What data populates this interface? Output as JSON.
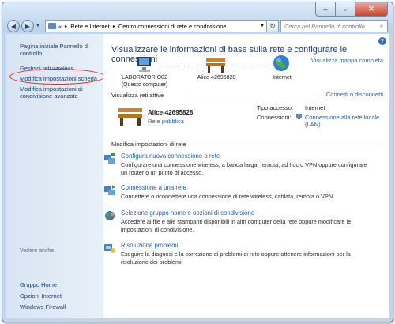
{
  "window": {
    "controls": {
      "minimize": "–",
      "maximize": "▫",
      "close": "✕"
    }
  },
  "nav": {
    "back_icon": "◀",
    "forward_icon": "▶",
    "dropdown_icon": "▼"
  },
  "address": {
    "sep0": "«",
    "crumb1": "Rete e Internet",
    "sep1": "▸",
    "crumb2": "Centro connessioni di rete e condivisione",
    "dropdown_icon": "▼",
    "refresh_icon": "↻"
  },
  "search": {
    "placeholder": "Cerca nel Pannello di controllo",
    "icon": "⌕"
  },
  "sidebar": {
    "items": [
      "Pagina iniziale Pannello di controllo",
      "Gestisci reti wireless",
      "Modifica impostazioni scheda",
      "Modifica impostazioni di condivisione avanzate"
    ],
    "see_also_title": "Vedere anche",
    "see_also": [
      "Gruppo Home",
      "Opzioni Internet",
      "Windows Firewall"
    ]
  },
  "main": {
    "help": "?",
    "heading": "Visualizzare le informazioni di base sulla rete e configurare le connessioni",
    "full_map_link": "Visualizza mappa completa",
    "map": {
      "computer_name": "LABORATORIO02",
      "computer_note": "(Questo computer)",
      "network_name": "Alice-42695828",
      "internet": "Internet"
    },
    "active": {
      "title": "Visualizza reti attive",
      "connect_link": "Connetti o disconnetti",
      "network_name": "Alice-42695828",
      "network_type": "Rete pubblica",
      "access_label": "Tipo accesso:",
      "access_value": "Internet",
      "connections_label": "Connessioni:",
      "connections_value_1": "Connessione alla rete locale",
      "connections_value_2": "(LAN)"
    },
    "settings_title": "Modifica impostazioni di rete",
    "tasks": [
      {
        "title": "Configura nuova connessione o rete",
        "desc": "Configurare una connessione wireless, a banda larga, remota, ad hoc o VPN oppure configurare un router o un punto di accesso."
      },
      {
        "title": "Connessione a una rete",
        "desc": "Connettere o riconnettere una connessione di rete wireless, cablata, remota o VPN."
      },
      {
        "title": "Selezione gruppo home e opzioni di condivisione",
        "desc": "Accedere ai file e alle stampanti disponibili in altri computer della rete oppure modificare le impostazioni di condivisione."
      },
      {
        "title": "Risoluzione problemi",
        "desc": "Eseguire la diagnosi e la correzione di problemi di rete oppure ottenere informazioni per la risoluzione dei problemi."
      }
    ]
  },
  "colors": {
    "highlight_circle": "#d9231b",
    "link": "#1f5fb5",
    "heading": "#1e3a6e"
  }
}
